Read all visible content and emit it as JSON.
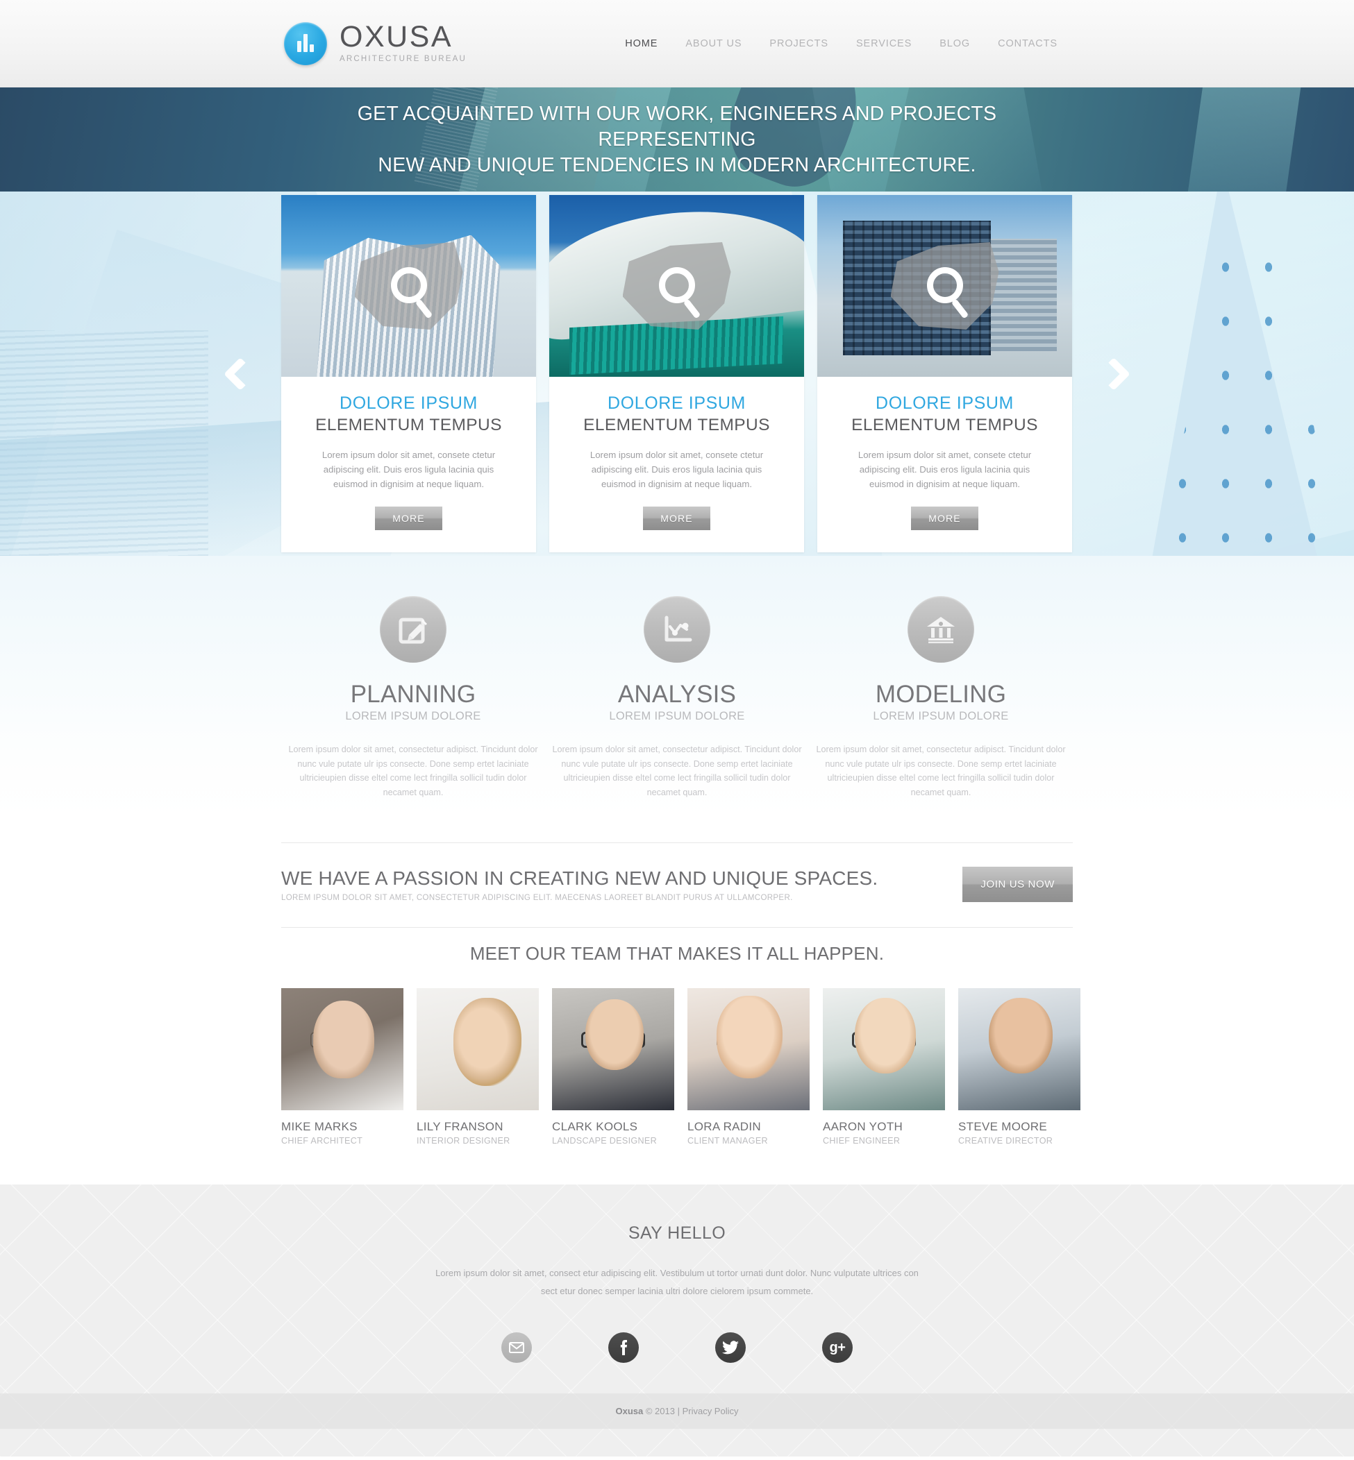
{
  "brand": {
    "name": "OXUSA",
    "tagline": "ARCHITECTURE BUREAU",
    "logo_icon": "bar-chart-icon",
    "accent_color": "#2fa7e0"
  },
  "nav": {
    "items": [
      {
        "label": "HOME",
        "active": true
      },
      {
        "label": "ABOUT US",
        "active": false
      },
      {
        "label": "PROJECTS",
        "active": false
      },
      {
        "label": "SERVICES",
        "active": false
      },
      {
        "label": "BLOG",
        "active": false
      },
      {
        "label": "CONTACTS",
        "active": false
      }
    ]
  },
  "hero": {
    "line1": "GET ACQUAINTED WITH OUR WORK, ENGINEERS AND PROJECTS REPRESENTING",
    "line2": "NEW AND UNIQUE TENDENCIES IN MODERN ARCHITECTURE."
  },
  "slider": {
    "prev_icon": "chevron-left-icon",
    "next_icon": "chevron-right-icon",
    "overlay_icon": "magnifier-icon",
    "cards": [
      {
        "title": "DOLORE IPSUM",
        "subtitle": "ELEMENTUM TEMPUS",
        "text": "Lorem ipsum dolor sit amet, consete ctetur adipiscing elit. Duis eros ligula lacinia quis euismod in dignisim at neque liquam.",
        "button": "MORE"
      },
      {
        "title": "DOLORE IPSUM",
        "subtitle": "ELEMENTUM TEMPUS",
        "text": "Lorem ipsum dolor sit amet, consete ctetur adipiscing elit. Duis eros ligula lacinia quis euismod in dignisim at neque liquam.",
        "button": "MORE"
      },
      {
        "title": "DOLORE IPSUM",
        "subtitle": "ELEMENTUM TEMPUS",
        "text": "Lorem ipsum dolor sit amet, consete ctetur adipiscing elit. Duis eros ligula lacinia quis euismod in dignisim at neque liquam.",
        "button": "MORE"
      }
    ]
  },
  "services": [
    {
      "icon": "pencil-edit-icon",
      "title": "PLANNING",
      "subtitle": "LOREM IPSUM DOLORE",
      "text": "Lorem ipsum dolor sit amet, consectetur adipisct. Tincidunt dolor nunc vule putate ulr ips consecte. Done semp ertet laciniate ultricieupien disse eltel come lect fringilla sollicil tudin dolor necamet quam."
    },
    {
      "icon": "line-chart-icon",
      "title": "ANALYSIS",
      "subtitle": "LOREM IPSUM DOLORE",
      "text": "Lorem ipsum dolor sit amet, consectetur adipisct. Tincidunt dolor nunc vule putate ulr ips consecte. Done semp ertet laciniate ultricieupien disse eltel come lect fringilla sollicil tudin dolor necamet quam."
    },
    {
      "icon": "bank-building-icon",
      "title": "MODELING",
      "subtitle": "LOREM IPSUM DOLORE",
      "text": "Lorem ipsum dolor sit amet, consectetur adipisct. Tincidunt dolor nunc vule putate ulr ips consecte. Done semp ertet laciniate ultricieupien disse eltel come lect fringilla sollicil tudin dolor necamet quam."
    }
  ],
  "passion": {
    "heading": "WE HAVE A PASSION IN CREATING NEW AND UNIQUE SPACES.",
    "subheading": "LOREM IPSUM DOLOR SIT AMET, CONSECTETUR ADIPISCING ELIT. MAECENAS LAOREET BLANDIT PURUS AT ULLAMCORPER.",
    "button": "JOIN US NOW"
  },
  "team": {
    "heading": "MEET OUR TEAM THAT MAKES IT ALL HAPPEN.",
    "members": [
      {
        "name": "MIKE MARKS",
        "role": "CHIEF ARCHITECT"
      },
      {
        "name": "LILY FRANSON",
        "role": "INTERIOR DESIGNER"
      },
      {
        "name": "CLARK KOOLS",
        "role": "LANDSCAPE DESIGNER"
      },
      {
        "name": "LORA RADIN",
        "role": "CLIENT MANAGER"
      },
      {
        "name": "AARON YOTH",
        "role": "CHIEF ENGINEER"
      },
      {
        "name": "STEVE MOORE",
        "role": "CREATIVE DIRECTOR"
      }
    ]
  },
  "footer": {
    "heading": "SAY HELLO",
    "text": "Lorem ipsum dolor sit amet, consect etur adipiscing elit. Vestibulum ut tortor urnati dunt dolor. Nunc vulputate ultrices con sect etur donec semper lacinia ultri  dolore cielorem ipsum commete.",
    "socials": [
      {
        "icon": "mail-icon",
        "name": "email"
      },
      {
        "icon": "facebook-icon",
        "name": "facebook"
      },
      {
        "icon": "twitter-icon",
        "name": "twitter"
      },
      {
        "icon": "google-plus-icon",
        "name": "google-plus"
      }
    ],
    "copyright_brand": "Oxusa",
    "copyright_rest": " © 2013 | Privacy Policy"
  }
}
